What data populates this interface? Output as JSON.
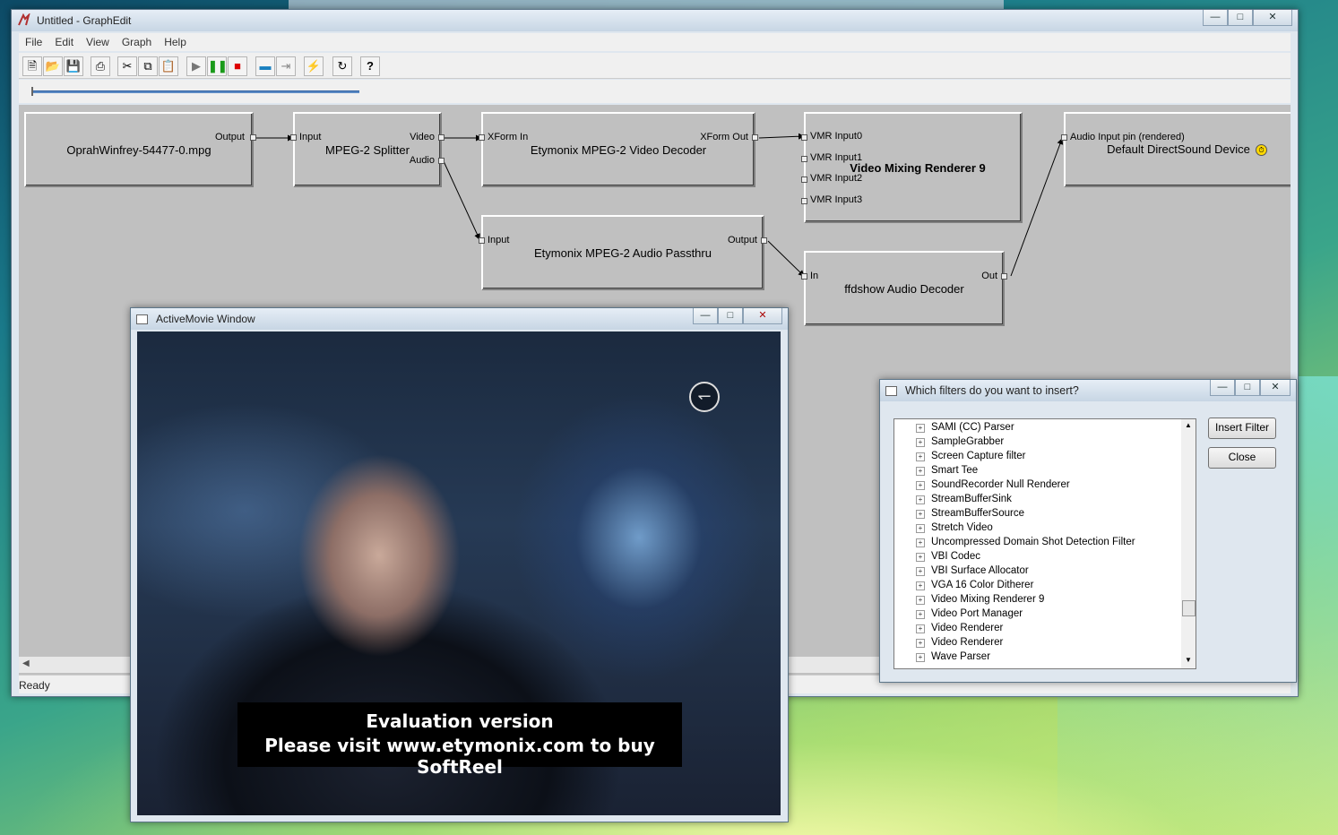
{
  "graphedit": {
    "title": "Untitled - GraphEdit",
    "menu": [
      "File",
      "Edit",
      "View",
      "Graph",
      "Help"
    ],
    "status": "Ready",
    "filters": {
      "source": {
        "name": "OprahWinfrey-54477-0.mpg",
        "out": "Output"
      },
      "splitter": {
        "name": "MPEG-2 Splitter",
        "in": "Input",
        "video": "Video",
        "audio": "Audio"
      },
      "vdec": {
        "name": "Etymonix MPEG-2 Video Decoder",
        "in": "XForm In",
        "out": "XForm Out"
      },
      "vmr": {
        "name": "Video Mixing Renderer 9",
        "pins": [
          "VMR Input0",
          "VMR Input1",
          "VMR Input2",
          "VMR Input3"
        ]
      },
      "dsound": {
        "name": "Default DirectSound Device",
        "in": "Audio Input pin (rendered)"
      },
      "adec_pass": {
        "name": "Etymonix MPEG-2 Audio Passthru",
        "in": "Input",
        "out": "Output"
      },
      "ffdshow": {
        "name": "ffdshow Audio Decoder",
        "in": "In",
        "out": "Out"
      }
    }
  },
  "activemovie": {
    "title": "ActiveMovie Window",
    "overlay_line1": "Evaluation version",
    "overlay_line2": "Please visit www.etymonix.com to buy SoftReel"
  },
  "insert_dialog": {
    "title": "Which filters do you want to insert?",
    "items": [
      "SAMI (CC) Parser",
      "SampleGrabber",
      "Screen Capture filter",
      "Smart Tee",
      "SoundRecorder Null Renderer",
      "StreamBufferSink",
      "StreamBufferSource",
      "Stretch Video",
      "Uncompressed Domain Shot Detection Filter",
      "VBI Codec",
      "VBI Surface Allocator",
      "VGA 16 Color Ditherer",
      "Video Mixing Renderer 9",
      "Video Port Manager",
      "Video Renderer",
      "Video Renderer",
      "Wave Parser"
    ],
    "insert_button": "Insert Filter",
    "close_button": "Close"
  },
  "colors": {
    "canvas": "#c0c0c0",
    "titlebar": "#c7d6e4",
    "overlay_bg": "#000000"
  }
}
